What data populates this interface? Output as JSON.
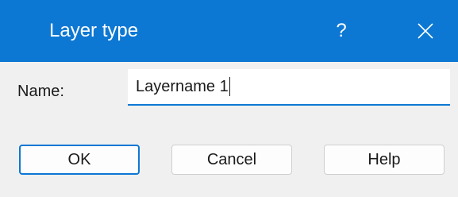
{
  "window": {
    "title": "Layer type",
    "help_glyph": "?",
    "close_icon": "close-icon",
    "accent_color": "#0d78d4"
  },
  "form": {
    "name_label": "Name:",
    "name_value": "Layername 1"
  },
  "buttons": {
    "ok_label": "OK",
    "cancel_label": "Cancel",
    "help_label": "Help"
  }
}
